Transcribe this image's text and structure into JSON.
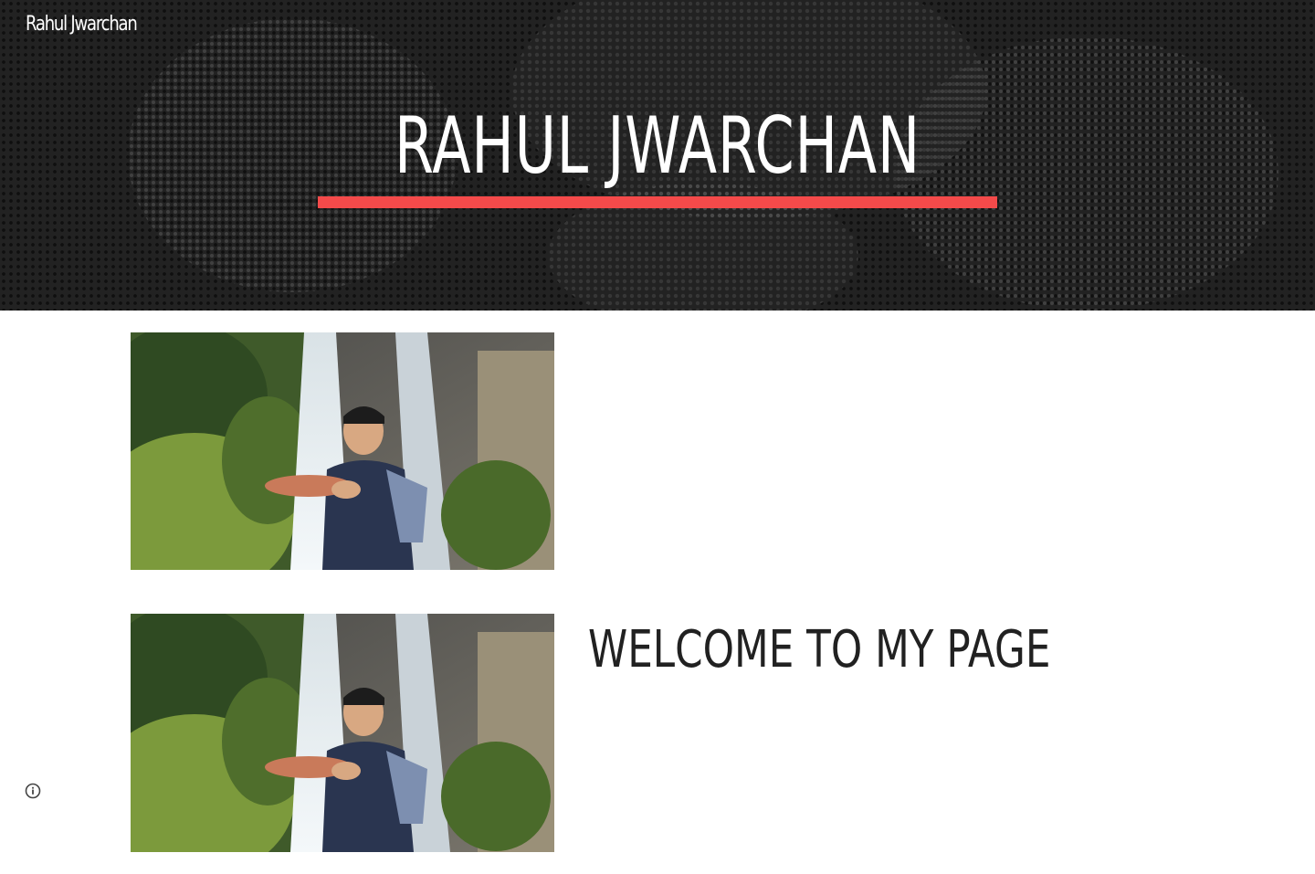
{
  "header": {
    "site_name": "Rahul Jwarchan",
    "hero_title": "RAHUL JWARCHAN",
    "accent_color": "#f44a4a",
    "background_color": "#222222"
  },
  "main": {
    "images": [
      {
        "name": "waterfall-photo",
        "description_icon": "photo"
      },
      {
        "name": "waterfall-photo",
        "description_icon": "photo"
      }
    ],
    "welcome_heading": "WELCOME TO MY PAGE"
  },
  "footer": {
    "info_icon": "info-circle-icon"
  }
}
